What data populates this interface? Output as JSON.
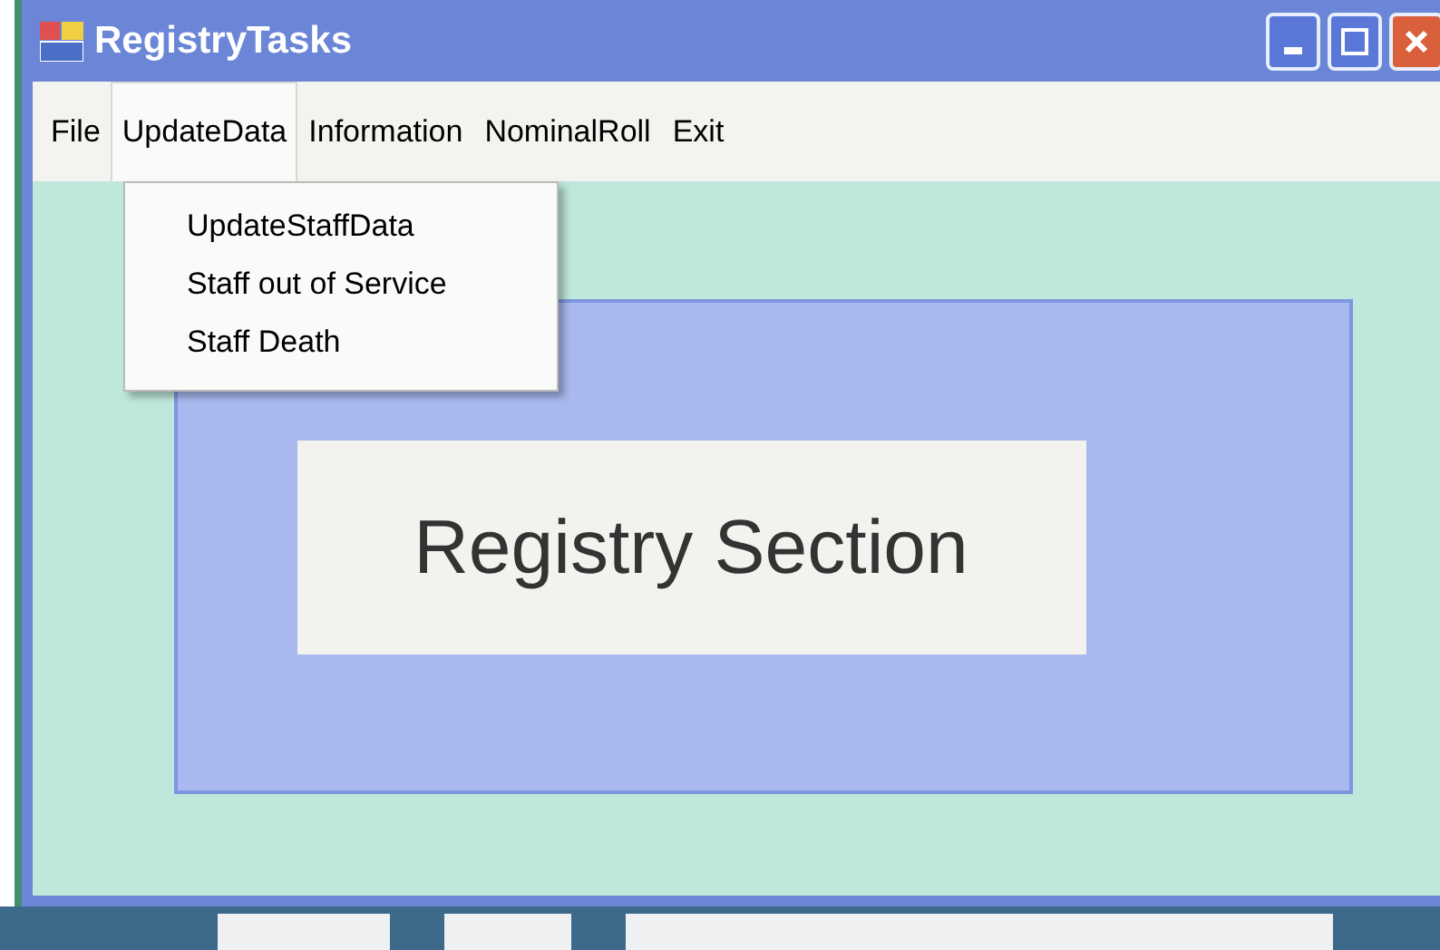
{
  "window": {
    "title": "RegistryTasks"
  },
  "menu": [
    {
      "label": "File",
      "selected": false
    },
    {
      "label": "UpdateData",
      "selected": true
    },
    {
      "label": "Information",
      "selected": false
    },
    {
      "label": "NominalRoll",
      "selected": false
    },
    {
      "label": "Exit",
      "selected": false
    }
  ],
  "dropdown": {
    "items": [
      "UpdateStaffData",
      "Staff out of Service",
      "Staff Death"
    ]
  },
  "panel": {
    "heading": "Registry Section"
  }
}
